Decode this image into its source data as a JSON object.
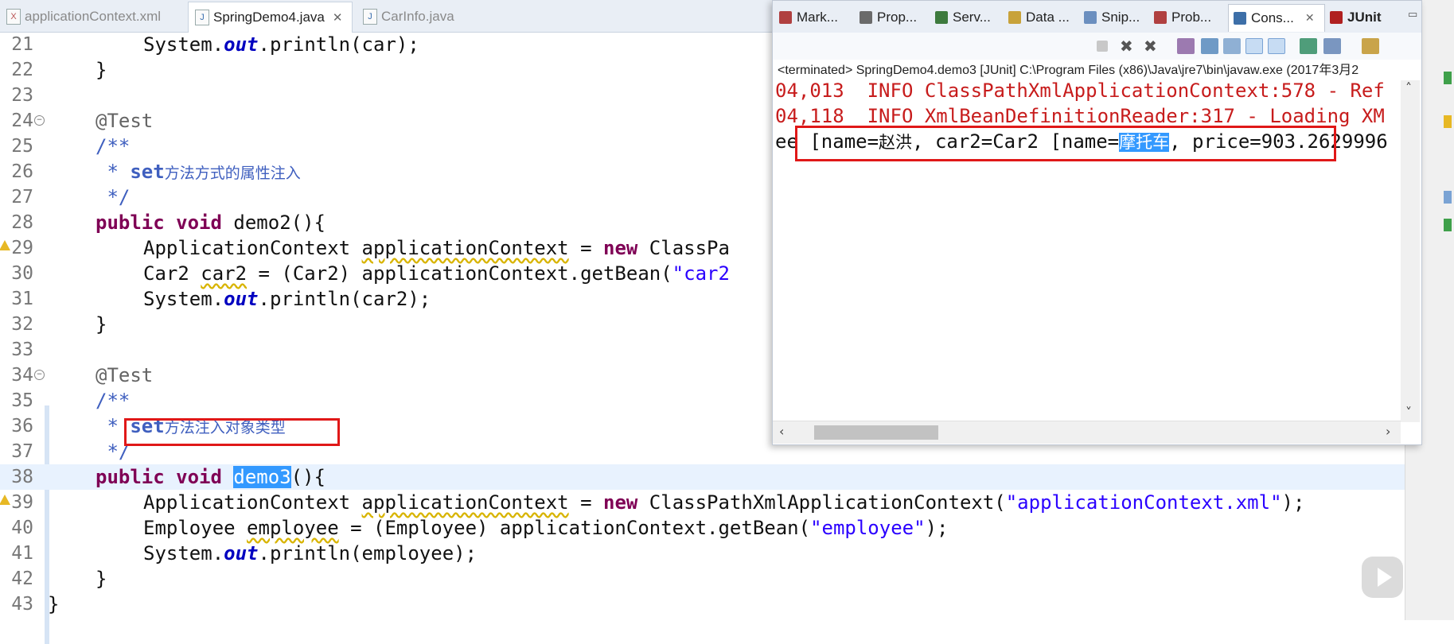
{
  "editor_tabs": [
    {
      "label": "applicationContext.xml",
      "icon": "xml-file-icon",
      "active": false
    },
    {
      "label": "SpringDemo4.java",
      "icon": "java-file-icon",
      "active": true,
      "close": "✕"
    },
    {
      "label": "CarInfo.java",
      "icon": "java-file-icon",
      "active": false
    }
  ],
  "line_numbers": [
    "21",
    "22",
    "23",
    "24",
    "25",
    "26",
    "27",
    "28",
    "29",
    "30",
    "31",
    "32",
    "33",
    "34",
    "35",
    "36",
    "37",
    "38",
    "39",
    "40",
    "41",
    "42",
    "43"
  ],
  "code": {
    "l21": {
      "a": "System.",
      "b": "out",
      "c": ".println(car);"
    },
    "l22": "}",
    "l24": "@Test",
    "l25": "/**",
    "l26": {
      "star": " * ",
      "kw": "set",
      "cn": "方法方式的属性注入"
    },
    "l27": " */",
    "l28": {
      "kw": "public void",
      "rest": " demo2(){"
    },
    "l29": {
      "t1": "ApplicationContext ",
      "v": "applicationContext",
      "t2": " = ",
      "kw": "new",
      "t3": " ClassPa"
    },
    "l30": {
      "t1": "Car2 ",
      "v": "car2",
      "t2": " = (Car2) applicationContext.getBean(",
      "s": "\"car2"
    },
    "l31": {
      "a": "System.",
      "b": "out",
      "c": ".println(car2);"
    },
    "l32": "}",
    "l34": "@Test",
    "l35": "/**",
    "l36": {
      "star": " * ",
      "kw": "set",
      "cn": "方法注入对象类型"
    },
    "l37": " */",
    "l38": {
      "kw": "public void",
      "sp": " ",
      "sel": "demo3",
      "rest": "(){"
    },
    "l39": {
      "t1": "ApplicationContext ",
      "v": "applicationContext",
      "t2": " = ",
      "kw": "new",
      "t3": " ClassPathXmlApplicationContext(",
      "s": "\"applicationContext.xml\"",
      "t4": ");"
    },
    "l40": {
      "t1": "Employee ",
      "v": "employee",
      "t2": " = (Employee) applicationContext.getBean(",
      "s": "\"employee\"",
      "t3": ");"
    },
    "l41": {
      "a": "System.",
      "b": "out",
      "c": ".println(employee);"
    },
    "l42": "}",
    "l43": "}"
  },
  "view_tabs": [
    {
      "label": "Mark...",
      "icon": "markers-icon",
      "color": "#b04040"
    },
    {
      "label": "Prop...",
      "icon": "properties-icon",
      "color": "#6a6a6a"
    },
    {
      "label": "Serv...",
      "icon": "servers-icon",
      "color": "#3d7a3d"
    },
    {
      "label": "Data ...",
      "icon": "data-source-icon",
      "color": "#c8a23a"
    },
    {
      "label": "Snip...",
      "icon": "snippets-icon",
      "color": "#6b8fbf"
    },
    {
      "label": "Prob...",
      "icon": "problems-icon",
      "color": "#b04040"
    },
    {
      "label": "Cons...",
      "icon": "console-icon",
      "color": "#3d6fa8",
      "active": true,
      "close": "✕"
    },
    {
      "label": "JUnit",
      "icon": "junit-icon",
      "color": "#b02020"
    }
  ],
  "minimize": "▭",
  "console": {
    "status": "<terminated> SpringDemo4.demo3 [JUnit] C:\\Program Files (x86)\\Java\\jre7\\bin\\javaw.exe (2017年3月2",
    "info_lines": [
      "04,013  INFO ClassPathXmlApplicationContext:578 - Ref",
      "04,118  INFO XmlBeanDefinitionReader:317 - Loading XM"
    ],
    "output": {
      "p1": "ee [name=",
      "cn1": "赵洪",
      "p2": ", car2=Car2 [name=",
      "sel": "摩托车",
      "p3": ", price=903.2629996"
    }
  },
  "scroll": {
    "left": "‹",
    "right": "›",
    "up": "˄",
    "down": "˅"
  }
}
